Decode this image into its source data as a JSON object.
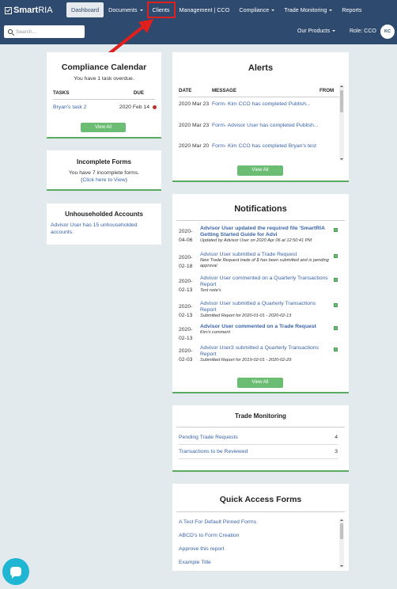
{
  "brand": {
    "name_bold": "Smart",
    "name_light": "RIA"
  },
  "nav": [
    {
      "label": "Dashboard",
      "active": true,
      "caret": false
    },
    {
      "label": "Documents",
      "active": false,
      "caret": true
    },
    {
      "label": "Clients",
      "active": false,
      "caret": false,
      "highlighted": true
    },
    {
      "label": "Management | CCO",
      "active": false,
      "caret": false
    },
    {
      "label": "Compliance",
      "active": false,
      "caret": true
    },
    {
      "label": "Trade Monitoring",
      "active": false,
      "caret": true
    },
    {
      "label": "Reports",
      "active": false,
      "caret": false
    }
  ],
  "search": {
    "placeholder": "Search..."
  },
  "products": "Our Products",
  "role": "Role: CCO",
  "avatar": "KC",
  "compliance_calendar": {
    "title": "Compliance Calendar",
    "subtitle": "You have 1 task overdue.",
    "col_tasks": "TASKS",
    "col_due": "DUE",
    "task": "Bryan's task 2",
    "due": "2020 Feb 14",
    "button": "View All"
  },
  "incomplete_forms": {
    "title": "Incomplete Forms",
    "line1": "You have 7 incomplete forms.",
    "line2_prefix": "(",
    "line2_link": "Click here to View",
    "line2_suffix": ")"
  },
  "unhouseholded": {
    "title": "Unhouseholded Accounts",
    "text": "Advisor User has 15 unhouseholded accounts."
  },
  "alerts": {
    "title": "Alerts",
    "col_date": "DATE",
    "col_message": "MESSAGE",
    "col_from": "FROM",
    "rows": [
      {
        "date": "2020 Mar 23",
        "message": "Form- Kim CCO has completed Publish..."
      },
      {
        "date": "2020 Mar 23",
        "message": "Form- Advisor User has completed Publish..."
      },
      {
        "date": "2020 Mar 20",
        "message": "Form- Kim CCO has completed Bryan's test"
      }
    ],
    "button": "View All"
  },
  "notifications": {
    "title": "Notifications",
    "items": [
      {
        "date": "2020-04-06",
        "title": "Advisor User updated the required file 'SmartRIA Getting Started Guide for Advi",
        "sub": "Updated by Advisor User on 2020 Apr 06 at 12:50:41 PM",
        "bold": true
      },
      {
        "date": "2020-02-18",
        "title": "Advisor User submitted a Trade Request",
        "sub": "New Trade Request trade of $ has been submitted and is pending approval",
        "bold": false
      },
      {
        "date": "2020-02-13",
        "title": "Advisor User commented on a Quarterly Transactions Report",
        "sub": "Test note's",
        "bold": false
      },
      {
        "date": "2020-02-13",
        "title": "Advisor User submitted a Quarterly Transactions Report",
        "sub": "Submitted Report for 2020-01-01 - 2020-02-13",
        "bold": false
      },
      {
        "date": "2020-02-13",
        "title": "Advisor User commented on a Trade Request",
        "sub": "Kim's comment",
        "bold": true
      },
      {
        "date": "2020-02-03",
        "title": "Advisor User3 submitted a Quarterly Transactions Report",
        "sub": "Submitted Report for 2019-02-01 - 2020-02-29",
        "bold": false
      }
    ],
    "button": "View All"
  },
  "trade_monitoring": {
    "title": "Trade Monitoring",
    "rows": [
      {
        "label": "Pending Trade Requests",
        "value": "4"
      },
      {
        "label": "Transactions to be Reviewed",
        "value": "3"
      }
    ]
  },
  "quick_access": {
    "title": "Quick Access Forms",
    "items": [
      "A Test For Default Pinned Forms",
      "ABCD's to Form Creation",
      "Approve this report",
      "Example Title"
    ]
  },
  "colors": {
    "navbar": "#2e4a6e",
    "accent_green": "#6cbd74",
    "link": "#3a63a8",
    "annotation_red": "#e0201c"
  }
}
